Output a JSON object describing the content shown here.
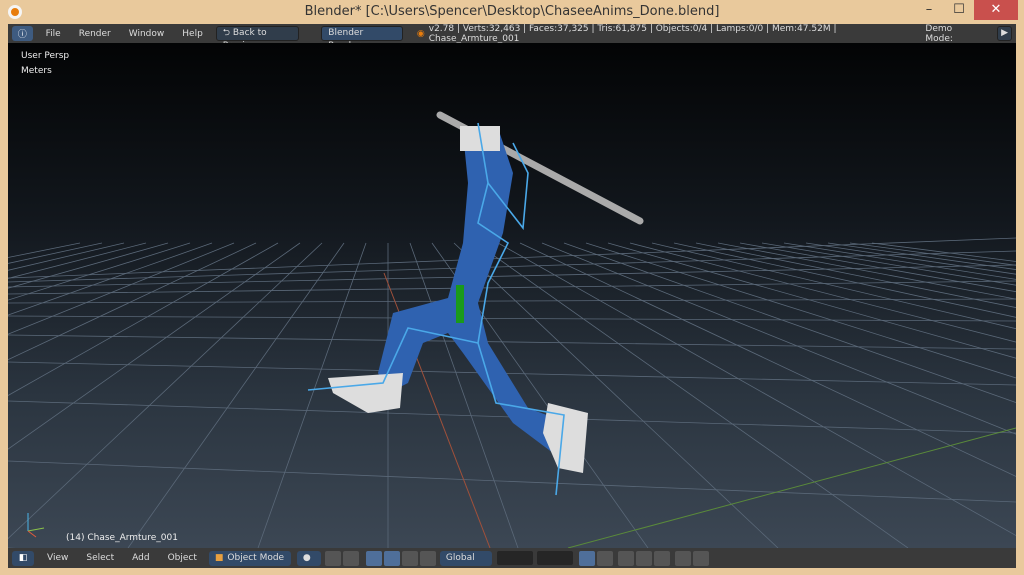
{
  "window": {
    "title": "Blender* [C:\\Users\\Spencer\\Desktop\\ChaseeAnims_Done.blend]",
    "minimize": "–",
    "maximize": "☐",
    "close": "✕"
  },
  "topbar": {
    "menus": [
      "File",
      "Render",
      "Window",
      "Help"
    ],
    "back_button": "Back to Previous",
    "render_engine": "Blender Render",
    "stats": "v2.78 | Verts:32,463 | Faces:37,325 | Tris:61,875 | Objects:0/4 | Lamps:0/0 | Mem:47.52M | Chase_Armture_001",
    "demo_mode": "Demo Mode:",
    "play": "▶"
  },
  "viewport": {
    "view_name": "User Persp",
    "units": "Meters",
    "object_label": "(14) Chase_Armture_001"
  },
  "bottombar": {
    "menus": [
      "View",
      "Select",
      "Add",
      "Object"
    ],
    "mode": "Object Mode",
    "orientation": "Global"
  },
  "colors": {
    "frame": "#e9c99c",
    "header": "#3a3a3a",
    "model": "#2f62b0",
    "bones": "#4aa8e8"
  }
}
